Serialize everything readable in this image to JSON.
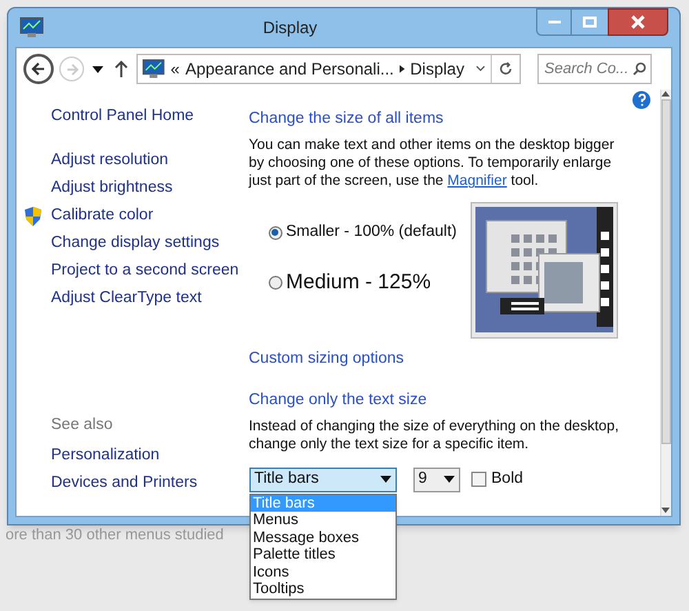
{
  "window": {
    "title": "Display"
  },
  "nav": {
    "back_disabled": false,
    "forward_disabled": true,
    "breadcrumb_prefix": "«",
    "breadcrumb": [
      "Appearance and Personali...",
      "Display"
    ],
    "search": {
      "placeholder": "Search Co..."
    }
  },
  "left_pane": {
    "home": "Control Panel Home",
    "tasks": [
      {
        "label": "Adjust resolution",
        "kind": "link"
      },
      {
        "label": "Adjust brightness",
        "kind": "link"
      },
      {
        "label": "Calibrate color",
        "kind": "shield"
      },
      {
        "label": "Change display settings",
        "kind": "link"
      },
      {
        "label": "Project to a second screen",
        "kind": "link"
      },
      {
        "label": "Adjust ClearType text",
        "kind": "link"
      }
    ],
    "see_also": {
      "heading": "See also",
      "items": [
        "Personalization",
        "Devices and Printers"
      ]
    }
  },
  "size_section": {
    "heading": "Change the size of all items",
    "text_before": "You can make text and other items on the desktop bigger by choosing one of these options. To temporarily enlarge just part of the screen, use the",
    "link": "Magnifier",
    "text_after": "tool.",
    "options": [
      {
        "label": "Smaller - 100% (default)",
        "selected": true,
        "kind": "small"
      },
      {
        "label": "Medium - 125%",
        "selected": false,
        "kind": "large"
      }
    ],
    "custom_link": "Custom sizing options"
  },
  "text_section": {
    "heading": "Change only the text size",
    "text": "Instead of changing the size of everything on the desktop, change only the text size for a specific item.",
    "item_select": {
      "value": "Title bars",
      "expanded": true,
      "options": [
        {
          "label": "Title bars",
          "selected": true
        },
        {
          "label": "Menus",
          "selected": false
        },
        {
          "label": "Message boxes",
          "selected": false
        },
        {
          "label": "Palette titles",
          "selected": false
        },
        {
          "label": "Icons",
          "selected": false
        },
        {
          "label": "Tooltips",
          "selected": false
        }
      ]
    },
    "size_select": {
      "value": "9"
    },
    "bold": {
      "label": "Bold",
      "checked": false
    }
  },
  "background_text": "ore than 30 other menus studied"
}
